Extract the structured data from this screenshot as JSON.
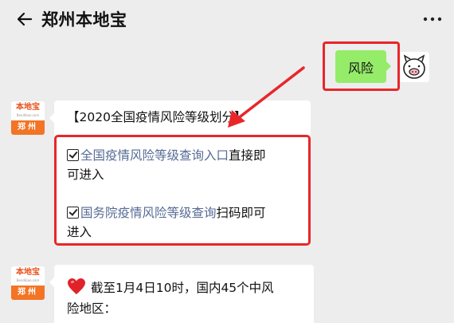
{
  "header": {
    "title": "郑州本地宝",
    "back_icon": "back-arrow-icon",
    "more_icon": "more-dots-icon"
  },
  "outgoing": {
    "text": "风险"
  },
  "bot": {
    "logo_top": "本地宝",
    "logo_mid": "Bendibao.com",
    "logo_bottom": "郑州"
  },
  "message1": {
    "heading": "【2020全国疫情风险等级划分】",
    "item1_link": "全国疫情风险等级查询入口",
    "item1_suffix": "直接即",
    "item1_line2": "可进入",
    "item2_link": "国务院疫情风险等级查询",
    "item2_suffix": "扫码即可",
    "item2_line2": "进入"
  },
  "message2": {
    "line1": "截至1月4日10时，国内45个中风",
    "line2": "险地区："
  },
  "colors": {
    "highlight": "#e8262a",
    "bubble_out": "#95ec69",
    "link": "#576b95"
  }
}
